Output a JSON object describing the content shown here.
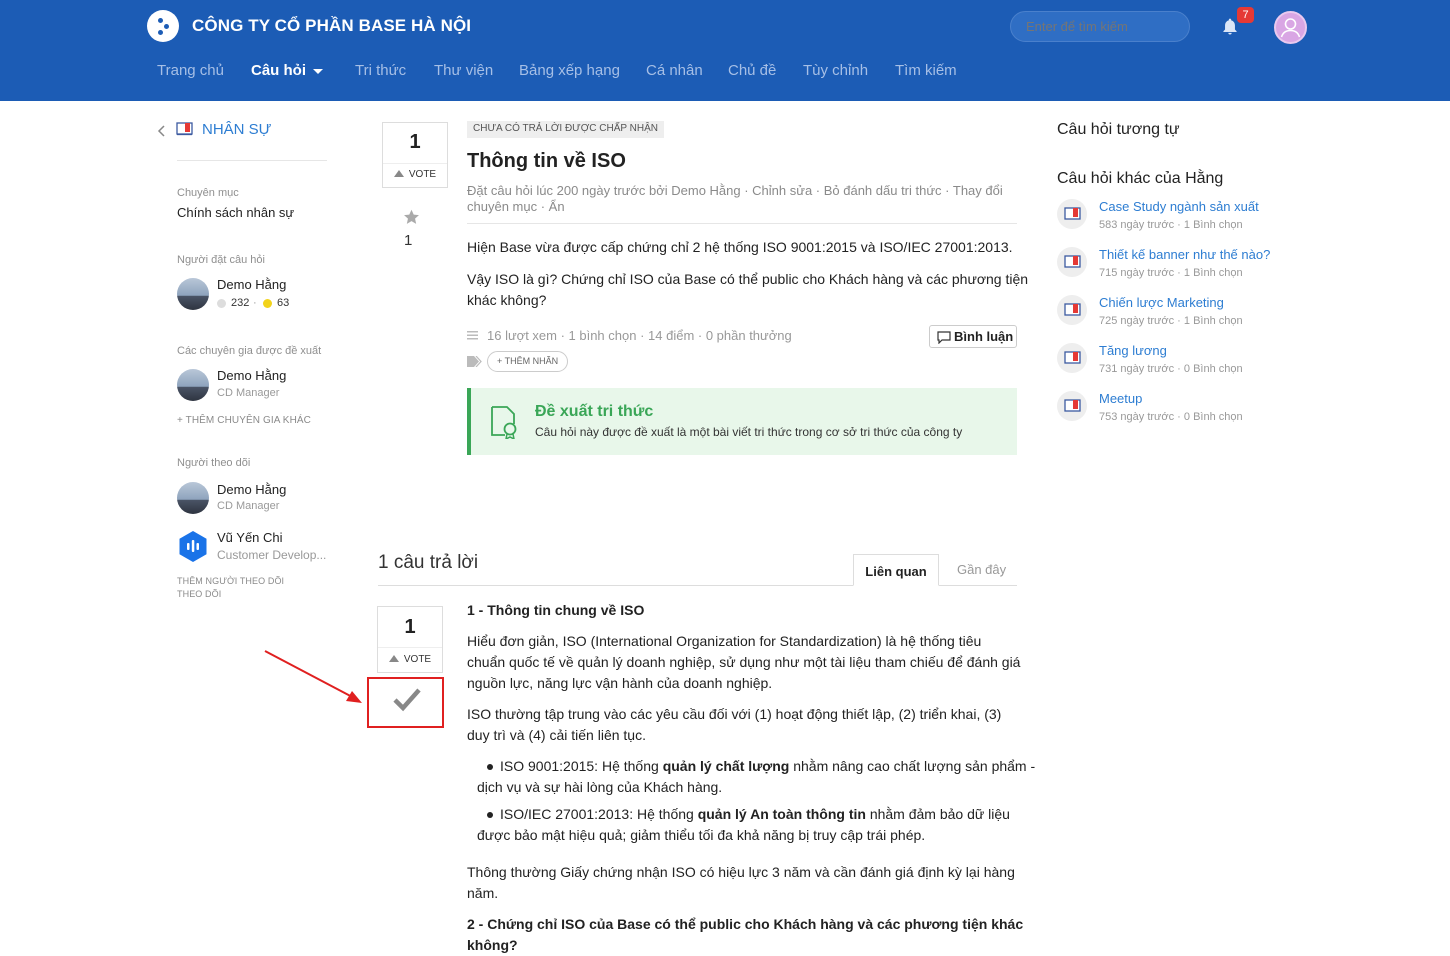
{
  "header": {
    "company": "CÔNG TY CỔ PHẦN BASE HÀ NỘI",
    "search_placeholder": "Enter để tìm kiếm",
    "notification_count": "7",
    "nav": [
      "Trang chủ",
      "Câu hỏi",
      "Tri thức",
      "Thư viện",
      "Bảng xếp hạng",
      "Cá nhân",
      "Chủ đề",
      "Tùy chỉnh",
      "Tìm kiếm"
    ]
  },
  "sidebar": {
    "back_label": "NHÂN SỰ",
    "category_label": "Chuyên mục",
    "category_value": "Chính sách nhân sự",
    "asker_label": "Người đặt câu hỏi",
    "asker_name": "Demo Hằng",
    "asker_points_grey": "232",
    "asker_points_gold": "63",
    "experts_label": "Các chuyên gia được đề xuất",
    "expert_name": "Demo Hằng",
    "expert_role": "CD Manager",
    "add_expert": "+ THÊM CHUYÊN GIA KHÁC",
    "followers_label": "Người theo dõi",
    "followers": [
      {
        "name": "Demo Hằng",
        "role": "CD Manager"
      },
      {
        "name": "Vũ Yến Chi",
        "role": "Customer Develop..."
      }
    ],
    "add_follower_line1": "THÊM NGƯỜI THEO DÕI",
    "add_follower_line2": "THEO DÕI"
  },
  "question": {
    "vote_count": "1",
    "vote_label": "VOTE",
    "star_count": "1",
    "status_badge": "CHƯA CÓ TRẢ LỜI ĐƯỢC CHẤP NHẬN",
    "title": "Thông tin về ISO",
    "meta_line1": "Đặt câu hỏi lúc 200 ngày trước bởi Demo Hằng · Chỉnh sửa · Bỏ đánh dấu tri thức · Thay đổi",
    "meta_line2": "chuyên mục · Ẩn",
    "body_p1": "Hiện Base vừa được cấp chứng chỉ 2 hệ thống ISO 9001:2015 và ISO/IEC 27001:2013.",
    "body_p2_line1": "Vậy ISO là gì? Chứng chỉ ISO của Base có thể public cho Khách hàng và các phương tiện",
    "body_p2_line2": "khác không?",
    "stats": "16 lượt xem · 1 bình chọn · 14 điểm · 0 phần thưởng",
    "comment_button": "Bình luận",
    "add_tag": "+ THÊM NHÃN",
    "suggest_title": "Đề xuất tri thức",
    "suggest_text": "Câu hỏi này được đề xuất là một bài viết tri thức trong cơ sở tri thức của công ty"
  },
  "answers": {
    "count_label": "1 câu trả lời",
    "tab_related": "Liên quan",
    "tab_recent": "Gần đây",
    "vote_count": "1",
    "vote_label": "VOTE",
    "h1": "1 - Thông tin chung về ISO",
    "p1_l1": "Hiểu đơn giản, ISO (International Organization for Standardization) là hệ thống tiêu",
    "p1_l2": "chuẩn quốc tế về quản lý doanh nghiệp, sử dụng như một tài liệu tham chiếu để đánh giá",
    "p1_l3": "nguồn lực, năng lực vận hành của doanh nghiệp.",
    "p2_l1": "ISO thường tập trung vào các yêu cầu đối với (1) hoạt động thiết lập, (2) triển khai, (3)",
    "p2_l2": "duy trì và (4) cải tiến liên tục.",
    "b1_pre": "ISO 9001:2015: Hệ thống ",
    "b1_bold": "quản lý chất lượng",
    "b1_post": " nhằm nâng cao chất lượng sản phẩm -",
    "b1_l2": "dịch vụ và sự hài lòng của Khách hàng.",
    "b2_pre": "ISO/IEC 27001:2013: Hệ thống ",
    "b2_bold": "quản lý An toàn thông tin",
    "b2_post": " nhằm đảm bảo dữ liệu",
    "b2_l2": "được bảo mật hiệu quả; giảm thiểu tối đa khả năng bị truy cập trái phép.",
    "p3_l1": "Thông thường Giấy chứng nhận ISO có hiệu lực 3 năm và cần đánh giá định kỳ lại hàng",
    "p3_l2": "năm.",
    "h2": "2 - Chứng chỉ ISO của Base có thể public cho Khách hàng và các phương tiện khác",
    "h2_l2": "không?"
  },
  "right": {
    "similar_title": "Câu hỏi tương tự",
    "other_title": "Câu hỏi khác của Hằng",
    "items": [
      {
        "title": "Case Study ngành sản xuất",
        "meta": "583 ngày trước · 1 Bình chọn"
      },
      {
        "title": "Thiết kế banner như thế nào?",
        "meta": "715 ngày trước · 1 Bình chọn"
      },
      {
        "title": "Chiến lược Marketing",
        "meta": "725 ngày trước · 1 Bình chọn"
      },
      {
        "title": "Tăng lương",
        "meta": "731 ngày trước · 0 Bình chọn"
      },
      {
        "title": "Meetup",
        "meta": "753 ngày trước · 0 Bình chọn"
      }
    ]
  },
  "colors": {
    "header_bg": "#1c5cb5",
    "link": "#2d7dd2",
    "suggest_green": "#3aa657",
    "suggest_bg": "#e8f7ea",
    "annotation_red": "#e02020"
  }
}
